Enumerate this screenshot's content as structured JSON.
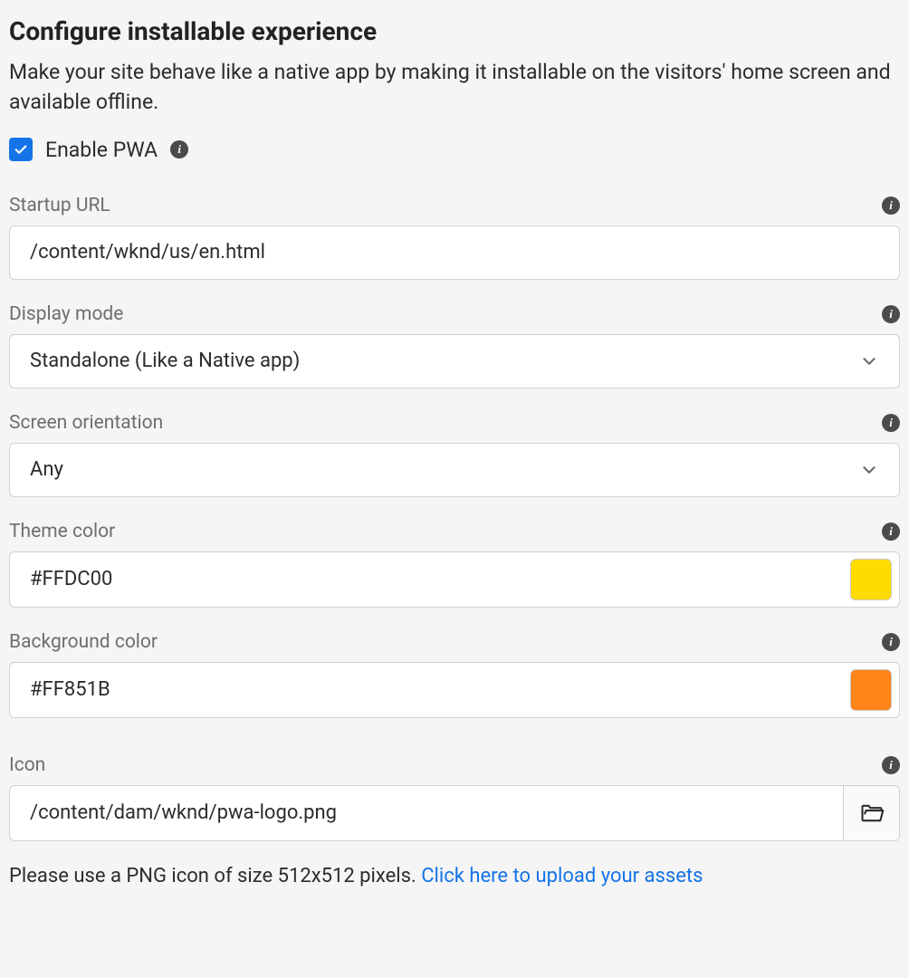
{
  "title": "Configure installable experience",
  "description": "Make your site behave like a native app by making it installable on the visitors' home screen and available offline.",
  "enable": {
    "label": "Enable PWA",
    "checked": true
  },
  "fields": {
    "startup_url": {
      "label": "Startup URL",
      "value": "/content/wknd/us/en.html"
    },
    "display_mode": {
      "label": "Display mode",
      "value": "Standalone (Like a Native app)"
    },
    "screen_orientation": {
      "label": "Screen orientation",
      "value": "Any"
    },
    "theme_color": {
      "label": "Theme color",
      "value": "#FFDC00",
      "swatch": "#FFDC00"
    },
    "background_color": {
      "label": "Background color",
      "value": "#FF851B",
      "swatch": "#FF851B"
    },
    "icon": {
      "label": "Icon",
      "value": "/content/dam/wknd/pwa-logo.png"
    }
  },
  "hint": {
    "text": "Please use a PNG icon of size 512x512 pixels. ",
    "link": "Click here to upload your assets"
  }
}
